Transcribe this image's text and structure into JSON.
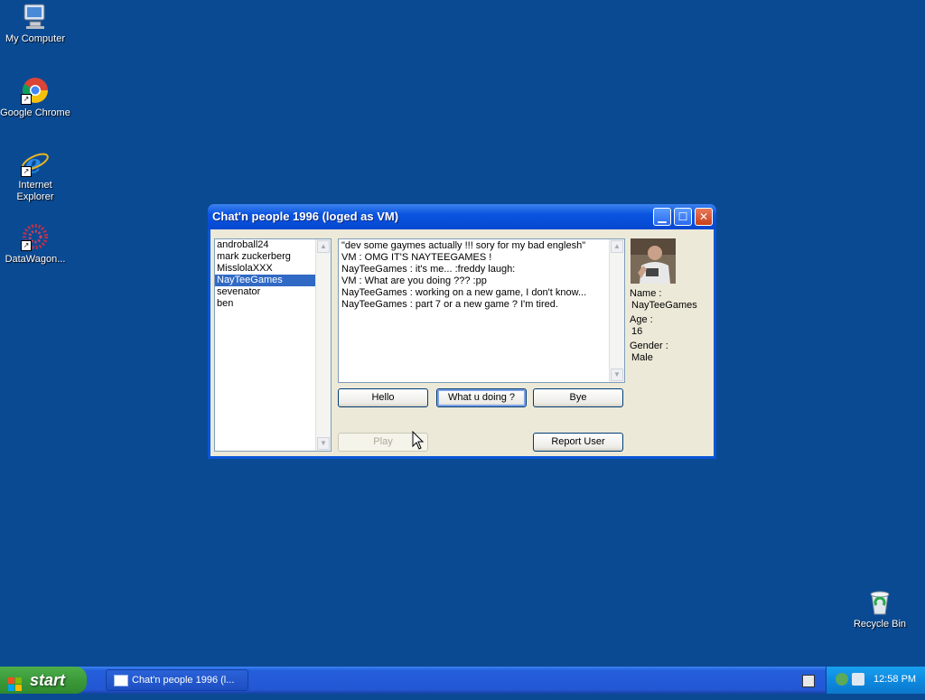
{
  "desktop": {
    "icons": [
      {
        "label": "My Computer",
        "icon": "my-computer-icon"
      },
      {
        "label": "Google Chrome",
        "icon": "chrome-icon"
      },
      {
        "label": "Internet Explorer",
        "icon": "internet-explorer-icon"
      },
      {
        "label": "DataWagon...",
        "icon": "datawagon-icon"
      },
      {
        "label": "Recycle Bin",
        "icon": "recycle-bin-icon"
      }
    ]
  },
  "window": {
    "title": "Chat'n people 1996 (loged as VM)",
    "users": [
      "androball24",
      "mark zuckerberg",
      "MisslolaXXX",
      "NayTeeGames",
      "sevenator",
      "ben"
    ],
    "selected_user_index": 3,
    "chat": [
      "\"dev some gaymes actually !!! sory for my bad englesh\"",
      "VM : OMG IT'S NAYTEEGAMES !",
      "NayTeeGames : it's me... :freddy laugh:",
      "VM : What are you doing ??? :pp",
      "NayTeeGames : working on a new game, I don't know...",
      "NayTeeGames :  part 7 or a new game ? I'm tired."
    ],
    "buttons": {
      "hello": "Hello",
      "what": "What u doing ?",
      "bye": "Bye",
      "play": "Play",
      "report": "Report User"
    },
    "profile": {
      "name_label": "Name :",
      "name": "NayTeeGames",
      "age_label": "Age :",
      "age": "16",
      "gender_label": "Gender :",
      "gender": "Male"
    }
  },
  "taskbar": {
    "start_label": "start",
    "task_label": "Chat'n people 1996 (l...",
    "clock": "12:58 PM"
  },
  "colors": {
    "desktop": "#0a4a93",
    "selection": "#316ac5",
    "titlebar": "#0a54e0"
  }
}
